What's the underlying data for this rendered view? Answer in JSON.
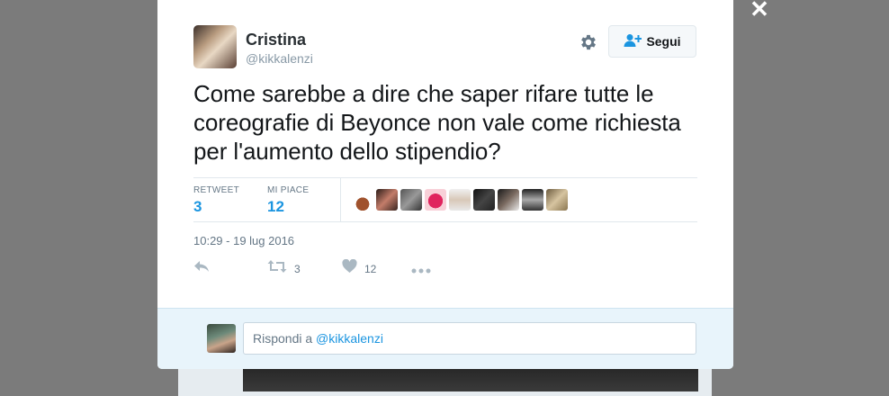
{
  "close": {
    "symbol": "✕"
  },
  "tweet": {
    "author": {
      "name": "Cristina",
      "handle": "@kikkalenzi"
    },
    "follow_label": "Segui",
    "text": "Come sarebbe a dire che saper rifare tutte le coreografie di Beyonce non vale come richiesta per l'aumento dello stipendio?",
    "stats": {
      "retweet_label": "RETWEET",
      "retweet_count": "3",
      "likes_label": "MI PIACE",
      "likes_count": "12"
    },
    "timestamp": "10:29 - 19 lug 2016",
    "actions": {
      "retweet_count": "3",
      "like_count": "12"
    }
  },
  "reply": {
    "prefix": "Rispondi a ",
    "mention": "@kikkalenzi"
  },
  "colors": {
    "accent": "#1b95e0",
    "text": "#14171a",
    "muted": "#657786",
    "reply_bg": "#e8f4fb"
  }
}
